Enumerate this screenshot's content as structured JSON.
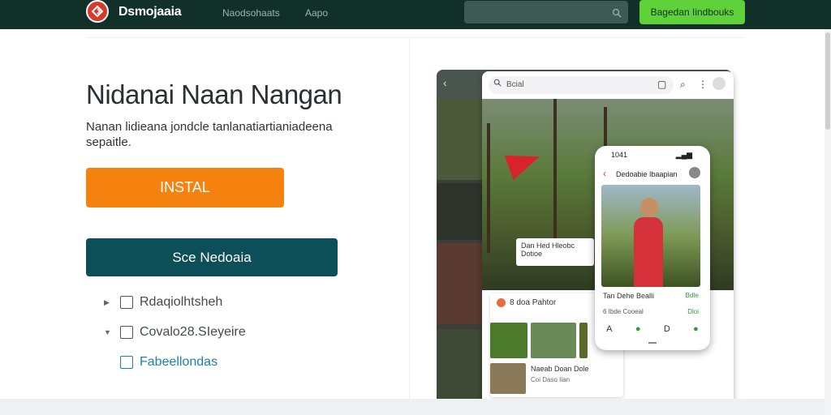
{
  "header": {
    "brand": "Dsmojaaia",
    "nav": [
      "Naodsohaats",
      "Aapo"
    ],
    "search_placeholder": "",
    "cta": "Bagedan Iindbouks"
  },
  "hero": {
    "title": "Nidanai Naan Nangan",
    "subtitle": "Nanan lidieana jondcle tanlanatiartianiadeena sepaitle.",
    "install_label": "INSTAL",
    "see_label": "Sce Nedoaia"
  },
  "options": [
    {
      "label": "Rdaqiolhtsheh"
    },
    {
      "label": "Covalo28.SIeyeire"
    },
    {
      "label": "Fabeellondas"
    }
  ],
  "browser_mock": {
    "url_text": "Bcial",
    "hero_caption": "Dan Hed Hleobc Dotioe",
    "card_title": "8 doa Pahtor",
    "card2_text": "Naeab Doan Dole",
    "card2_sub": "Coi Daso Iian"
  },
  "phone_mock": {
    "status_time": "1041",
    "title": "Dedoabie Ibaapian",
    "caption": "Tan Dehe Bealli",
    "caption_green": "BdIe",
    "caption2": "6 Ibde Cooeal",
    "caption2_green": "Dloi",
    "nav_icons": [
      "A",
      "●",
      "D",
      "●"
    ]
  },
  "colors": {
    "topbar": "#12302a",
    "install": "#f5820f",
    "see": "#0c4f58",
    "cta_top": "#5fd23a"
  }
}
